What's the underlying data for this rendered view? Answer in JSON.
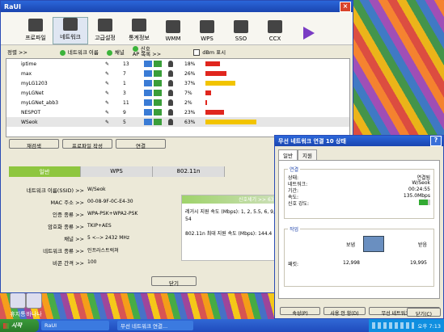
{
  "desktop": {
    "icons": [
      {
        "label": "휴지통"
      },
      {
        "label": "바나나"
      }
    ]
  },
  "raui": {
    "title": "RaUI",
    "toolbar": [
      {
        "label": "프로파일"
      },
      {
        "label": "네트워크"
      },
      {
        "label": "고급설정"
      },
      {
        "label": "통계정보"
      },
      {
        "label": "WMM"
      },
      {
        "label": "WPS"
      },
      {
        "label": "SSO"
      },
      {
        "label": "CCX"
      }
    ],
    "filter": {
      "sort_label": "정렬 >>",
      "opt1": "네트워크 이름",
      "opt2": "채널",
      "opt3": "신호",
      "ap_list": "AP 목록 >>",
      "dbm": "dBm 표시"
    },
    "networks": [
      {
        "name": "iptime",
        "signal": 13,
        "pct": "18%",
        "bar_pct": 18,
        "color": "#e0261e"
      },
      {
        "name": "max",
        "signal": 7,
        "pct": "26%",
        "bar_pct": 26,
        "color": "#e0261e"
      },
      {
        "name": "myLG1203",
        "signal": 1,
        "pct": "37%",
        "bar_pct": 37,
        "color": "#f2c400"
      },
      {
        "name": "myLGNet",
        "signal": 3,
        "pct": "7%",
        "bar_pct": 7,
        "color": "#e0261e"
      },
      {
        "name": "myLGNet_abb3",
        "signal": 11,
        "pct": "2%",
        "bar_pct": 2,
        "color": "#e0261e"
      },
      {
        "name": "NESPOT",
        "signal": 9,
        "pct": "23%",
        "bar_pct": 23,
        "color": "#e0261e"
      },
      {
        "name": "WSeok",
        "signal": 5,
        "pct": "63%",
        "bar_pct": 63,
        "color": "#f2c400"
      }
    ],
    "buttons": {
      "rescan": "재검색",
      "add_profile": "프로파일 작성",
      "connect": "연결"
    },
    "tabs": [
      {
        "label": "일반"
      },
      {
        "label": "WPS"
      },
      {
        "label": "802.11n"
      }
    ],
    "details": [
      {
        "k": "네트워크 이름(SSID) >>",
        "v": "W/Seok"
      },
      {
        "k": "MAC 주소 >>",
        "v": "00-08-9F-0C-E4-30"
      },
      {
        "k": "인증 종류 >>",
        "v": "WPA-PSK+WPA2-PSK"
      },
      {
        "k": "암호화 종류 >>",
        "v": "TKIP+AES"
      },
      {
        "k": "채널 >>",
        "v": "5 <--> 2432 MHz"
      },
      {
        "k": "네트워크 종류 >>",
        "v": "인프라스트럭쳐"
      },
      {
        "k": "비콘 간격 >>",
        "v": "100"
      }
    ],
    "info": {
      "header": "신호세기 >> 63%",
      "line1": "레거시 지원 속도 (Mbps): 1, 2, 5.5, 6, 9, 11, 12, 18, 24, 36, 48, 54",
      "line2": "802.11n 최대 지원 속도 (Mbps): 144.4"
    },
    "close": "닫기"
  },
  "status": {
    "title": "무선 네트워크 연결 10 상태",
    "tabs": [
      {
        "label": "일반"
      },
      {
        "label": "지원"
      }
    ],
    "conn_group": "연결",
    "conn": [
      {
        "k": "상태:",
        "v": "연결됨"
      },
      {
        "k": "네트워크:",
        "v": "W/Seok"
      },
      {
        "k": "기간:",
        "v": "00:24:55"
      },
      {
        "k": "속도:",
        "v": "135.0Mbps"
      },
      {
        "k": "신호 강도:",
        "v": ""
      }
    ],
    "act_group": "작업",
    "sent": "보냄",
    "recv": "받음",
    "packets_label": "패킷:",
    "packets_sent": "12,998",
    "packets_recv": "19,995",
    "btn_props": "속성(P)",
    "btn_disable": "사용 안 함(D)",
    "btn_view": "무선 네트워크 보기(V)",
    "close": "닫기(C)"
  },
  "taskbar": {
    "start": "시작",
    "task1": "RaUI",
    "task2": "무선 네트워크 연결...",
    "clock": "오후 7:13"
  }
}
